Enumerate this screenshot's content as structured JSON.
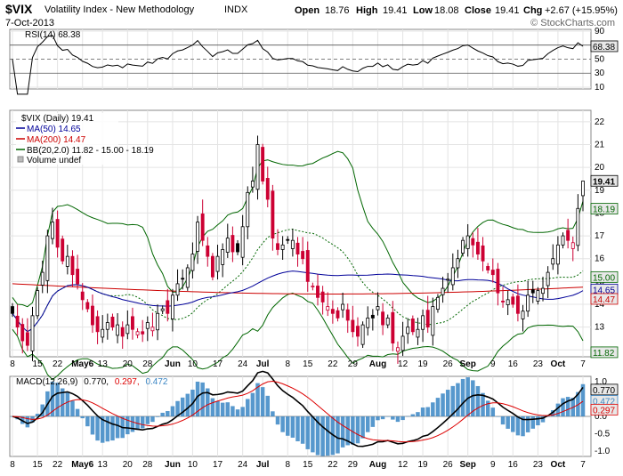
{
  "header": {
    "symbol": "$VIX",
    "name": "Volatility Index - New Methodology",
    "exchange": "INDX",
    "date": "7-Oct-2013",
    "open_label": "Open",
    "open": "18.76",
    "high_label": "High",
    "high": "19.41",
    "low_label": "Low",
    "low": "18.08",
    "close_label": "Close",
    "close": "19.41",
    "chg_label": "Chg",
    "chg": "+2.67 (+15.95%)",
    "watermark": "© StockCharts.com"
  },
  "rsi": {
    "legend": "RSI(14) 68.38",
    "value_tag": "68.38",
    "tick_labels": [
      "90",
      "70",
      "50",
      "30",
      "10"
    ]
  },
  "main": {
    "legend_title": "$VIX (Daily) 19.41",
    "legend_ma50": "MA(50) 14.65",
    "legend_ma200": "MA(200) 14.47",
    "legend_bb": "BB(20,2.0) 11.82 - 15.00 - 18.19",
    "legend_volume": "Volume undef",
    "y_tick_labels": [
      "22",
      "21",
      "20",
      "19",
      "18",
      "17",
      "16",
      "15",
      "14",
      "13",
      "12"
    ],
    "price_tags": [
      "19.41",
      "18.19",
      "15.00",
      "14.65",
      "14.47",
      "11.82"
    ]
  },
  "macd": {
    "legend_name": "MACD(12,26,9)",
    "legend_macd": "0.770,",
    "legend_signal": "0.297,",
    "legend_hist": "0.472",
    "value_tags": [
      "0.770",
      "0.472",
      "0.297"
    ],
    "y_tick_labels": [
      "1.0",
      "0.5",
      "0.0",
      "-0.5",
      "-1.0"
    ]
  },
  "x_axis": {
    "labels": [
      "8",
      "15",
      "22",
      "May6",
      "13",
      "20",
      "28",
      "Jun",
      "10",
      "17",
      "24",
      "Jul",
      "8",
      "15",
      "22",
      "29",
      "Aug",
      "12",
      "19",
      "26",
      "Sep",
      "9",
      "16",
      "23",
      "Oct",
      "7"
    ]
  },
  "colors": {
    "up": "#000000",
    "down": "#cc0033",
    "ma50": "#000099",
    "ma200": "#cc0000",
    "bollinger_band": "#006600",
    "bollinger_mid": "#006600",
    "macd_hist": "#3a86c4",
    "macd_line": "#000000",
    "signal_line": "#dd0000",
    "rsi_line": "#000000",
    "tag_bg": "#e8e8e8"
  },
  "chart_data": {
    "type": "candlestick",
    "symbol": "$VIX",
    "period": "Daily",
    "last": {
      "open": 18.76,
      "high": 19.41,
      "low": 18.08,
      "close": 19.41,
      "chg": 2.67,
      "chg_pct": 15.95
    },
    "price_ylim": [
      12,
      22.5
    ],
    "indicators": {
      "ma50": 14.65,
      "ma200": 14.47,
      "bb_lower": 11.82,
      "bb_mid": 15.0,
      "bb_upper": 18.19,
      "rsi14": 68.38,
      "macd": 0.77,
      "signal": 0.297,
      "histogram": 0.472
    },
    "rsi_ylim": [
      10,
      90
    ],
    "rsi_reference_lines": [
      30,
      50,
      70
    ],
    "macd_ylim": [
      -1.1,
      1.1
    ],
    "close_series": [
      13.6,
      13.0,
      12.4,
      12.2,
      13.5,
      14.6,
      15.4,
      17.0,
      17.6,
      16.5,
      15.9,
      16.1,
      15.3,
      14.9,
      14.2,
      13.8,
      13.1,
      12.8,
      12.9,
      13.2,
      13.0,
      13.1,
      12.6,
      13.1,
      12.9,
      12.8,
      12.7,
      13.2,
      13.0,
      13.6,
      13.8,
      13.6,
      14.4,
      14.9,
      15.1,
      15.6,
      16.2,
      17.6,
      16.8,
      16.1,
      15.2,
      16.1,
      16.4,
      16.9,
      16.3,
      16.3,
      17.4,
      18.9,
      19.4,
      21.0,
      19.4,
      18.6,
      16.9,
      16.4,
      16.6,
      16.8,
      16.8,
      16.2,
      16.0,
      15.0,
      14.8,
      14.3,
      14.1,
      13.9,
      13.6,
      13.4,
      14.0,
      13.3,
      12.8,
      12.6,
      13.1,
      13.4,
      13.4,
      13.9,
      13.1,
      13.4,
      12.3,
      12.1,
      12.6,
      13.0,
      12.8,
      12.9,
      13.5,
      13.0,
      13.9,
      14.3,
      14.7,
      15.1,
      15.6,
      16.0,
      16.8,
      17.0,
      16.6,
      16.2,
      15.9,
      15.5,
      15.3,
      14.5,
      14.1,
      14.2,
      14.0,
      13.6,
      13.7,
      14.4,
      14.5,
      14.6,
      14.7,
      15.4,
      16.0,
      16.6,
      17.0,
      16.8,
      16.7,
      18.2,
      19.4
    ]
  }
}
